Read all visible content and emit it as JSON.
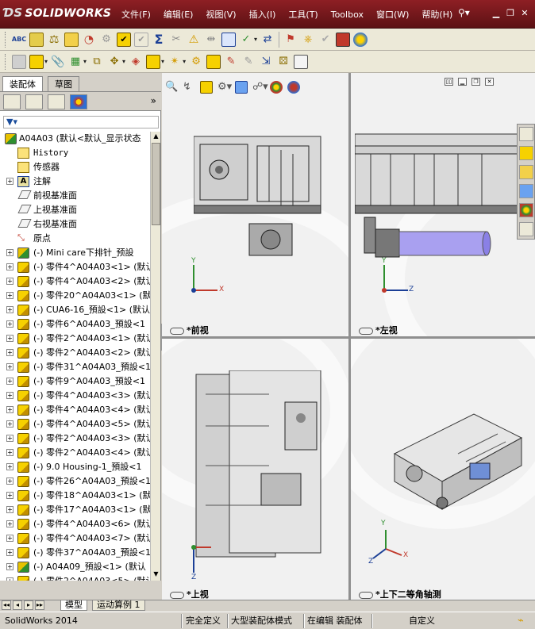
{
  "app": {
    "logo": "SOLIDWORKS",
    "menu": [
      "文件(F)",
      "编辑(E)",
      "视图(V)",
      "插入(I)",
      "工具(T)",
      "Toolbox",
      "窗口(W)",
      "帮助(H)"
    ]
  },
  "panel": {
    "tabs": [
      "装配体",
      "草图"
    ],
    "more": "»",
    "filter_icon": "funnel-icon"
  },
  "tree": {
    "root": "A04A03  (默认<默认_显示状态",
    "items": [
      {
        "label": "History",
        "icon": "history-icon",
        "mono": true
      },
      {
        "label": "传感器",
        "icon": "sensor-icon"
      },
      {
        "label": "注解",
        "icon": "annotation-icon",
        "expand": true
      },
      {
        "label": "前视基准面",
        "icon": "plane-icon"
      },
      {
        "label": "上视基准面",
        "icon": "plane-icon"
      },
      {
        "label": "右视基准面",
        "icon": "plane-icon"
      },
      {
        "label": "原点",
        "icon": "origin-icon"
      },
      {
        "label": "(-) Mini care下排针_预設",
        "icon": "assembly-icon",
        "expand": true
      },
      {
        "label": "(-) 零件4^A04A03<1> (默认",
        "icon": "part-icon",
        "expand": true
      },
      {
        "label": "(-) 零件4^A04A03<2> (默认",
        "icon": "part-icon",
        "expand": true
      },
      {
        "label": "(-) 零件20^A04A03<1> (默",
        "icon": "part-icon",
        "expand": true
      },
      {
        "label": "(-) CUA6-16_預設<1> (默认",
        "icon": "part-icon",
        "expand": true
      },
      {
        "label": "(-) 零件6^A04A03_預設<1",
        "icon": "part-icon",
        "expand": true
      },
      {
        "label": "(-) 零件2^A04A03<1> (默认",
        "icon": "part-icon",
        "expand": true
      },
      {
        "label": "(-) 零件2^A04A03<2> (默认",
        "icon": "part-icon",
        "expand": true
      },
      {
        "label": "(-) 零件31^A04A03_預設<1",
        "icon": "part-icon",
        "expand": true
      },
      {
        "label": "(-) 零件9^A04A03_預設<1",
        "icon": "part-icon",
        "expand": true
      },
      {
        "label": "(-) 零件4^A04A03<3> (默认",
        "icon": "part-icon",
        "expand": true
      },
      {
        "label": "(-) 零件4^A04A03<4> (默认",
        "icon": "part-icon",
        "expand": true
      },
      {
        "label": "(-) 零件4^A04A03<5> (默认",
        "icon": "part-icon",
        "expand": true
      },
      {
        "label": "(-) 零件2^A04A03<3> (默认",
        "icon": "part-icon",
        "expand": true
      },
      {
        "label": "(-) 零件2^A04A03<4> (默认",
        "icon": "part-icon",
        "expand": true
      },
      {
        "label": "(-) 9.0 Housing-1_預設<1",
        "icon": "part-icon",
        "expand": true
      },
      {
        "label": "(-) 零件26^A04A03_預設<1",
        "icon": "part-icon",
        "expand": true
      },
      {
        "label": "(-) 零件18^A04A03<1> (默",
        "icon": "part-icon",
        "expand": true
      },
      {
        "label": "(-) 零件17^A04A03<1> (默",
        "icon": "part-icon",
        "expand": true
      },
      {
        "label": "(-) 零件4^A04A03<6> (默认",
        "icon": "part-icon",
        "expand": true
      },
      {
        "label": "(-) 零件4^A04A03<7> (默认",
        "icon": "part-icon",
        "expand": true
      },
      {
        "label": "(-) 零件37^A04A03_預設<1",
        "icon": "part-icon",
        "expand": true
      },
      {
        "label": "(-) A04A09_預設<1> (默认",
        "icon": "assembly-icon",
        "expand": true
      },
      {
        "label": "(-) 零件2^A04A03<5> (默认",
        "icon": "part-icon",
        "expand": true
      }
    ]
  },
  "viewports": {
    "front": "*前视",
    "left": "*左视",
    "top": "*上视",
    "iso": "*上下二等角轴测"
  },
  "axes": {
    "x": "X",
    "y": "Y",
    "z": "Z"
  },
  "bottom_tabs": [
    "模型",
    "运动算例 1"
  ],
  "status": {
    "app": "SolidWorks 2014",
    "defined": "完全定义",
    "mode": "大型装配体模式",
    "editing": "在编辑 装配体",
    "custom": "自定义"
  }
}
